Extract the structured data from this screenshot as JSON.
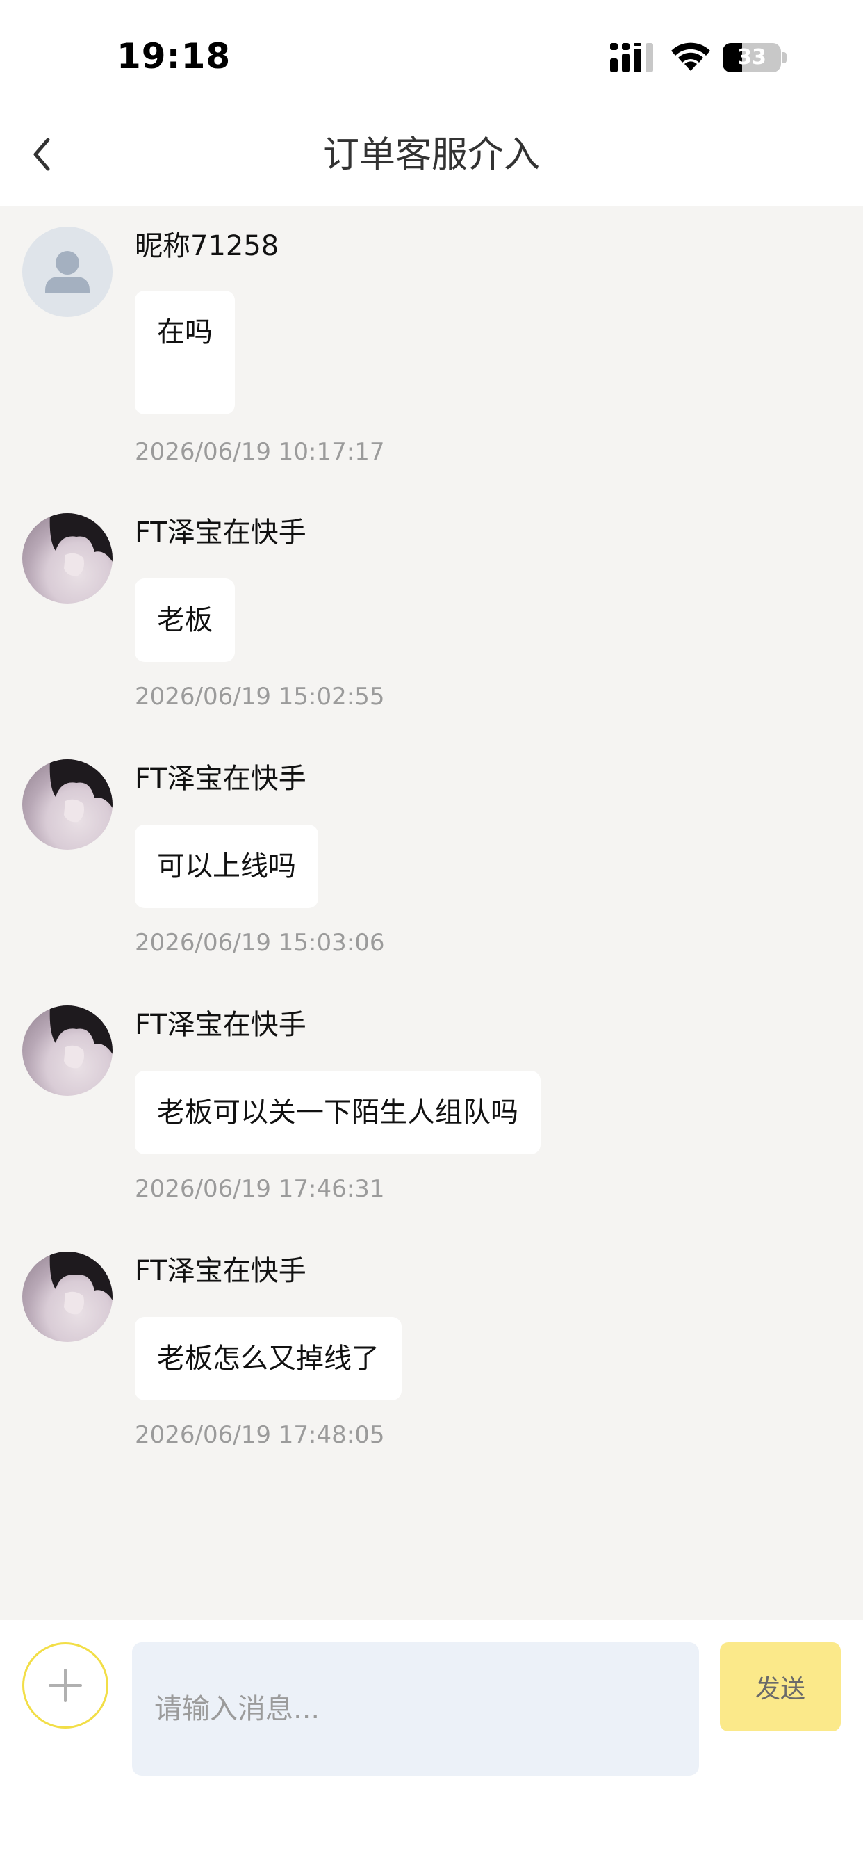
{
  "status_bar": {
    "time": "19:18",
    "battery_level": "33",
    "battery_fraction": 0.33
  },
  "nav": {
    "title": "订单客服介入",
    "back_icon": "chevron-left-icon"
  },
  "messages": [
    {
      "sender": "昵称71258",
      "text": "在吗",
      "time": "2026/06/19 10:17:17",
      "avatar": "default-user-icon"
    },
    {
      "sender": "FT泽宝在快手",
      "text": "老板",
      "time": "2026/06/19 15:02:55",
      "avatar": "user-photo"
    },
    {
      "sender": "FT泽宝在快手",
      "text": "可以上线吗",
      "time": "2026/06/19 15:03:06",
      "avatar": "user-photo"
    },
    {
      "sender": "FT泽宝在快手",
      "text": "老板可以关一下陌生人组队吗",
      "time": "2026/06/19 17:46:31",
      "avatar": "user-photo"
    },
    {
      "sender": "FT泽宝在快手",
      "text": "老板怎么又掉线了",
      "time": "2026/06/19 17:48:05",
      "avatar": "user-photo"
    }
  ],
  "input_bar": {
    "placeholder": "请输入消息...",
    "value": "",
    "send_label": "发送",
    "plus_icon": "plus-icon"
  },
  "colors": {
    "chat_background": "#f5f4f2",
    "accent_yellow": "#f2de47",
    "send_button": "#fbe98a",
    "input_background": "#ecf1f8"
  }
}
